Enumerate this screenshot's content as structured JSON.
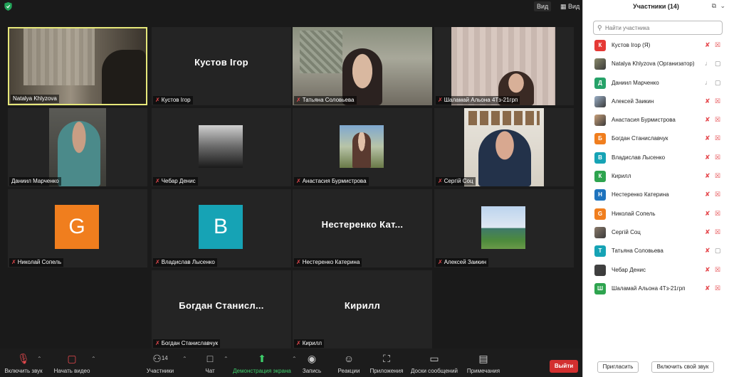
{
  "topbar": {
    "view_label": "Вид",
    "layout_label": "Вид"
  },
  "tiles": [
    {
      "label": "Natalya Khlyzova",
      "big": "",
      "avatar": "",
      "mic_muted": false
    },
    {
      "label": "Кустов Ігор",
      "big": "Кустов Ігор",
      "avatar": "",
      "mic_muted": true
    },
    {
      "label": "Татьяна Соловьева",
      "big": "",
      "avatar": "",
      "mic_muted": true
    },
    {
      "label": "Шаламай Альона 4Тз-21грп",
      "big": "",
      "avatar": "",
      "mic_muted": true
    },
    {
      "label": "Даниил Марченко",
      "big": "",
      "avatar": "",
      "mic_muted": false
    },
    {
      "label": "Чебар Денис",
      "big": "",
      "avatar": "",
      "mic_muted": true
    },
    {
      "label": "Анастасия Бурмистрова",
      "big": "",
      "avatar": "",
      "mic_muted": true
    },
    {
      "label": "Сергій Соц",
      "big": "",
      "avatar": "",
      "mic_muted": true
    },
    {
      "label": "Николай Сопель",
      "big": "",
      "avatar": "G",
      "avatar_color": "#f07e1e",
      "mic_muted": true
    },
    {
      "label": "Владислав Лысенко",
      "big": "",
      "avatar": "B",
      "avatar_color": "#16a3b5",
      "mic_muted": true
    },
    {
      "label": "Нестеренко Катерина",
      "big": "Нестеренко Кат...",
      "avatar": "",
      "mic_muted": true
    },
    {
      "label": "Алексей Заикин",
      "big": "",
      "avatar": "",
      "mic_muted": true
    },
    {
      "label": "Богдан Станиславчук",
      "big": "Богдан Станисл...",
      "avatar": "",
      "mic_muted": true
    },
    {
      "label": "Кирилл",
      "big": "Кирилл",
      "avatar": "",
      "mic_muted": true
    }
  ],
  "toolbar": {
    "unmute": "Включить звук",
    "start_video": "Начать видео",
    "participants": "Участники",
    "participants_count": "14",
    "chat": "Чат",
    "share": "Демонстрация экрана",
    "record": "Запись",
    "reactions": "Реакции",
    "apps": "Приложения",
    "whiteboards": "Доски сообщений",
    "notes": "Примечания",
    "leave": "Выйти"
  },
  "panel": {
    "title": "Участники (14)",
    "search_placeholder": "Найти участника",
    "invite": "Пригласить",
    "unmute_self": "Включить свой звук",
    "participants": [
      {
        "initial": "К",
        "color": "#e53935",
        "name": "Кустов Ігор (Я)",
        "mic_on": false,
        "cam_on": false,
        "photo": false
      },
      {
        "initial": "",
        "color": "#8a8a6a",
        "name": "Natalya Khlyzova (Организатор)",
        "mic_on": true,
        "cam_on": true,
        "photo": true
      },
      {
        "initial": "Д",
        "color": "#26a269",
        "name": "Даниил Марченко",
        "mic_on": true,
        "cam_on": true,
        "photo": false
      },
      {
        "initial": "",
        "color": "#9bb0c8",
        "name": "Алексей Заикин",
        "mic_on": false,
        "cam_on": false,
        "photo": true
      },
      {
        "initial": "",
        "color": "#c9a07a",
        "name": "Анастасия Бурмистрова",
        "mic_on": false,
        "cam_on": false,
        "photo": true
      },
      {
        "initial": "Б",
        "color": "#f07e1e",
        "name": "Богдан Станиславчук",
        "mic_on": false,
        "cam_on": false,
        "photo": false
      },
      {
        "initial": "В",
        "color": "#16a3b5",
        "name": "Владислав Лысенко",
        "mic_on": false,
        "cam_on": false,
        "photo": false
      },
      {
        "initial": "К",
        "color": "#2ea44f",
        "name": "Кирилл",
        "mic_on": false,
        "cam_on": false,
        "photo": false
      },
      {
        "initial": "Н",
        "color": "#1e73be",
        "name": "Нестеренко Катерина",
        "mic_on": false,
        "cam_on": false,
        "photo": false
      },
      {
        "initial": "G",
        "color": "#f07e1e",
        "name": "Николай Сопель",
        "mic_on": false,
        "cam_on": false,
        "photo": false
      },
      {
        "initial": "",
        "color": "#8a7a6a",
        "name": "Сергій Соц",
        "mic_on": false,
        "cam_on": false,
        "photo": true
      },
      {
        "initial": "Т",
        "color": "#16a3b5",
        "name": "Татьяна Соловьева",
        "mic_on": false,
        "cam_on": true,
        "photo": false
      },
      {
        "initial": "",
        "color": "#444444",
        "name": "Чебар Денис",
        "mic_on": false,
        "cam_on": false,
        "photo": true
      },
      {
        "initial": "Ш",
        "color": "#2ea44f",
        "name": "Шаламай Альона 4Тз-21грп",
        "mic_on": false,
        "cam_on": false,
        "photo": false
      }
    ]
  }
}
